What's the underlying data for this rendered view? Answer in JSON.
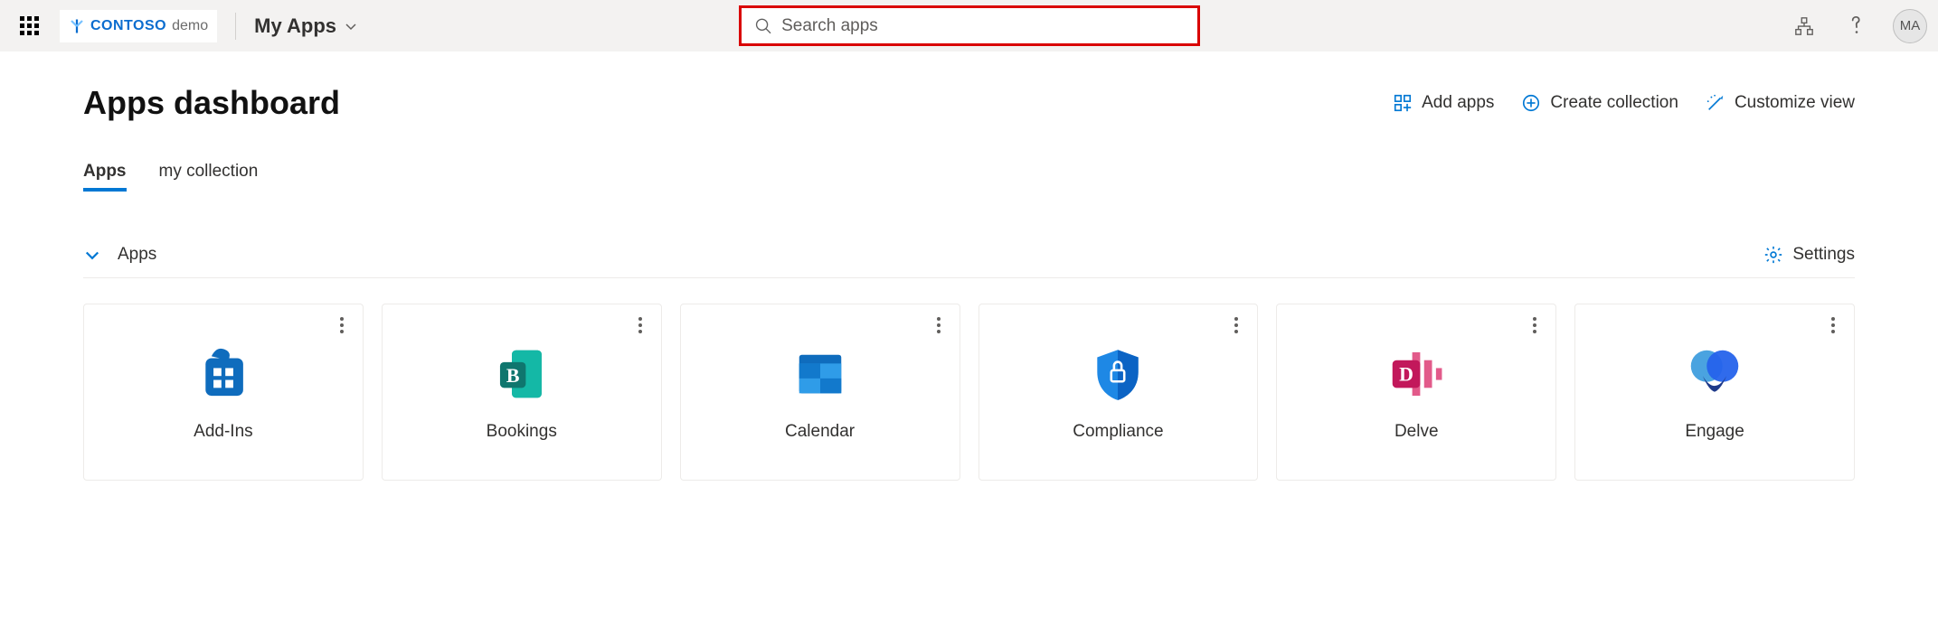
{
  "header": {
    "org_brand": "CONTOSO",
    "org_suffix": "demo",
    "app_title": "My Apps",
    "search_placeholder": "Search apps",
    "avatar_initials": "MA"
  },
  "page": {
    "title": "Apps dashboard",
    "actions": {
      "add_apps": "Add apps",
      "create_collection": "Create collection",
      "customize_view": "Customize view"
    }
  },
  "tabs": [
    {
      "label": "Apps",
      "active": true
    },
    {
      "label": "my collection",
      "active": false
    }
  ],
  "section": {
    "title": "Apps",
    "settings_label": "Settings"
  },
  "apps": [
    {
      "name": "Add-Ins",
      "icon": "addins"
    },
    {
      "name": "Bookings",
      "icon": "bookings"
    },
    {
      "name": "Calendar",
      "icon": "calendar"
    },
    {
      "name": "Compliance",
      "icon": "compliance"
    },
    {
      "name": "Delve",
      "icon": "delve"
    },
    {
      "name": "Engage",
      "icon": "engage"
    }
  ]
}
